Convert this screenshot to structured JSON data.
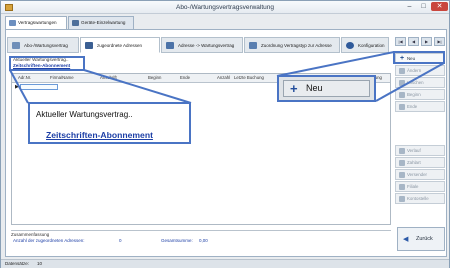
{
  "window": {
    "title": "Abo-/Wartungsvertragsverwaltung",
    "min": "–",
    "max": "□",
    "close": "✕"
  },
  "main_tabs": [
    {
      "label": "Vertragswartungen"
    },
    {
      "label": "Geräte-Einzelwartung"
    }
  ],
  "sub_tabs": [
    {
      "label": "Abo-/Wartungsvertrag",
      "icon": "contract-icon"
    },
    {
      "label": "zugeordnete Adressen",
      "icon": "people-icon"
    },
    {
      "label": "Adresse -> Wartungsvertrag",
      "icon": "address-icon"
    },
    {
      "label": "Zuordnung Vertragstyp zur Adresse",
      "icon": "mapping-icon"
    },
    {
      "label": "Konfiguration",
      "icon": "gear-icon"
    }
  ],
  "nav": {
    "first": "|◀",
    "prev": "◀",
    "next": "▶",
    "last": "▶|"
  },
  "contract": {
    "label": "Aktueller Wartungsvertrag..",
    "value": "Zeitschriften-Abonnement"
  },
  "grid": {
    "columns": [
      "Adr.Nr.",
      "Firma/Name",
      "Anschrift",
      "Beginn",
      "Ende",
      "Anzahl",
      "Letzte Buchung",
      "Nächste Buchung"
    ],
    "row_marker": "▶"
  },
  "sidebar": [
    {
      "label": "Neu",
      "enabled": true,
      "icon": "plus-icon"
    },
    {
      "label": "Ändern",
      "enabled": false,
      "icon": "edit-icon"
    },
    {
      "label": "Löschen",
      "enabled": false,
      "icon": "delete-icon"
    },
    {
      "label": "Beginn",
      "enabled": false,
      "icon": "start-icon"
    },
    {
      "label": "Ende",
      "enabled": false,
      "icon": "end-icon"
    },
    {
      "label": "Verlauf",
      "enabled": false,
      "icon": "history-icon"
    },
    {
      "label": "Zahlart",
      "enabled": false,
      "icon": "payment-icon"
    },
    {
      "label": "Versender",
      "enabled": false,
      "icon": "sender-icon"
    },
    {
      "label": "Filiale",
      "enabled": false,
      "icon": "branch-icon"
    },
    {
      "label": "Kontostelle",
      "enabled": false,
      "icon": "account-icon"
    }
  ],
  "back_button": {
    "label": "Zurück",
    "icon": "back-arrow-icon"
  },
  "summary": {
    "title": "Zusammenfassung",
    "count_label": "Anzahl der zugeordneten Adressen:",
    "count_value": "0",
    "total_label": "Gesamtsumme:",
    "total_value": "0,00"
  },
  "status": {
    "records_label": "Datensätze:",
    "records_value": "10"
  },
  "callout_new": {
    "label": "Neu",
    "plus": "+"
  },
  "colors": {
    "accent": "#4a74c4",
    "link": "#1d3fa6",
    "close": "#c9463d"
  }
}
